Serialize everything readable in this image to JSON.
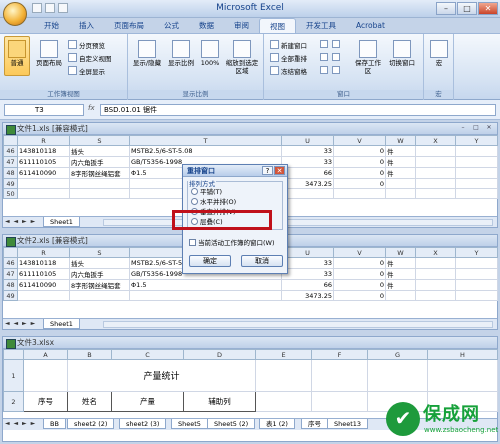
{
  "app": {
    "title": "Microsoft Excel"
  },
  "tabs": [
    "开始",
    "插入",
    "页面布局",
    "公式",
    "数据",
    "审阅",
    "视图",
    "开发工具",
    "Acrobat"
  ],
  "active_tab": "视图",
  "ribbon": {
    "groups": [
      {
        "label": "工作簿视图",
        "big": [
          "普通",
          "页面布局"
        ],
        "small": [
          "分页预览",
          "自定义视图",
          "全屏显示"
        ]
      },
      {
        "label": "显示比例",
        "big": [
          "显示/隐藏",
          "显示比例",
          "100%",
          "缩放到选定区域"
        ]
      },
      {
        "label": "窗口",
        "small": [
          "新建窗口",
          "全部重排",
          "冻结窗格"
        ],
        "big": [
          "保存工作区",
          "切换窗口"
        ]
      },
      {
        "label": "宏",
        "big": [
          "宏"
        ]
      }
    ]
  },
  "formula_bar": {
    "name_box": "T3",
    "fx": "fx",
    "value": "BSD.01.01 锯件"
  },
  "workbook1": {
    "title": "文件1.xls  [兼容模式]",
    "columns": [
      "R",
      "S",
      "T",
      "U",
      "V",
      "W",
      "X",
      "Y"
    ],
    "rows": [
      {
        "n": "46",
        "r": "143810118",
        "s": "插头",
        "t": "MSTB2.5/6-ST-5.08",
        "u": "33",
        "v": "0",
        "w": "件"
      },
      {
        "n": "47",
        "r": "611110105",
        "s": "内六角扳手",
        "t": "GB/T5356-1998",
        "u": "33",
        "v": "0",
        "w": "件"
      },
      {
        "n": "48",
        "r": "611410090",
        "s": "8字形钢丝绳铝套",
        "t": "Φ1.5",
        "u": "66",
        "v": "0",
        "w": "件"
      },
      {
        "n": "49",
        "r": "",
        "s": "",
        "t": "",
        "u": "3473.25",
        "v": "0",
        "w": ""
      },
      {
        "n": "50",
        "r": "",
        "s": "",
        "t": "",
        "u": "",
        "v": "",
        "w": ""
      }
    ],
    "sheet_tab": "Sheet1"
  },
  "workbook2": {
    "title": "文件2.xls  [兼容模式]",
    "columns": [
      "R",
      "S",
      "T",
      "U",
      "V",
      "W",
      "X",
      "Y"
    ],
    "rows": [
      {
        "n": "46",
        "r": "143810118",
        "s": "插头",
        "t": "MSTB2.5/6-ST-5.08",
        "u": "33",
        "v": "0",
        "w": "件"
      },
      {
        "n": "47",
        "r": "611110105",
        "s": "内六角扳手",
        "t": "GB/T5356-1998",
        "u": "33",
        "v": "0",
        "w": "件"
      },
      {
        "n": "48",
        "r": "611410090",
        "s": "8字形钢丝绳铝套",
        "t": "Φ1.5",
        "u": "66",
        "v": "0",
        "w": "件"
      },
      {
        "n": "49",
        "r": "",
        "s": "",
        "t": "",
        "u": "3473.25",
        "v": "0",
        "w": ""
      }
    ],
    "sheet_tab": "Sheet1"
  },
  "workbook3": {
    "title": "文件3.xlsx",
    "columns": [
      "A",
      "B",
      "C",
      "D",
      "E",
      "F",
      "G",
      "H"
    ],
    "title_cell": "产量统计",
    "headers": [
      "序号",
      "姓名",
      "产量",
      "辅助列"
    ],
    "row_numbers": [
      "1",
      "2"
    ],
    "sheet_tabs": [
      "BB",
      "sheet2 (2)",
      "sheet2 (3)",
      "Sheet5",
      "Sheet5 (2)",
      "表1 (2)",
      "序号",
      "Sheet13"
    ]
  },
  "dialog": {
    "title": "重排窗口",
    "group_label": "排列方式",
    "options": [
      "平铺(T)",
      "水平并排(O)",
      "垂直并排(V)",
      "层叠(C)"
    ],
    "selected": "垂直并排(V)",
    "checkbox": "当前活动工作簿的窗口(W)",
    "ok": "确定",
    "cancel": "取消"
  },
  "watermark": {
    "brand": "保成网",
    "url": "www.zsbaocheng.net"
  },
  "colors": {
    "ribbon_bg": "#d6e3f3",
    "highlight_col": "#f8d98a",
    "red_box": "#c0101a",
    "watermark": "#16a13a"
  }
}
